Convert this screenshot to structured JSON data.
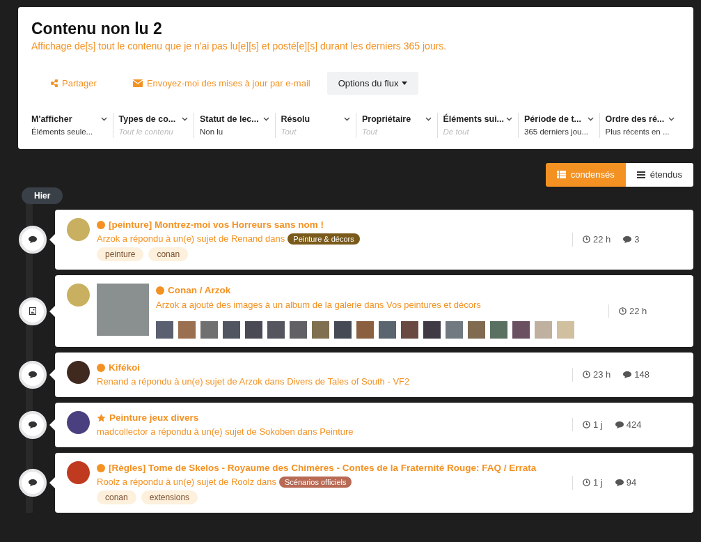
{
  "header": {
    "title": "Contenu non lu 2",
    "subtitle": "Affichage de[s] tout le contenu que je n'ai pas lu[e][s] et posté[e][s] durant les derniers 365 jours."
  },
  "actions": {
    "share": "Partager",
    "email": "Envoyez-moi des mises à jour par e-mail",
    "options": "Options du flux"
  },
  "filters": [
    {
      "label": "M'afficher",
      "value": "Éléments seule...",
      "muted": false
    },
    {
      "label": "Types de co...",
      "value": "Tout le contenu",
      "muted": true
    },
    {
      "label": "Statut de lec...",
      "value": "Non lu",
      "muted": false
    },
    {
      "label": "Résolu",
      "value": "Tout",
      "muted": true
    },
    {
      "label": "Propriétaire",
      "value": "Tout",
      "muted": true
    },
    {
      "label": "Éléments sui...",
      "value": "De tout",
      "muted": true
    },
    {
      "label": "Période de t...",
      "value": "365 derniers jou...",
      "muted": false
    },
    {
      "label": "Ordre des ré...",
      "value": "Plus récents en ...",
      "muted": false
    }
  ],
  "view_toggle": [
    {
      "label": "condensés",
      "selected": true
    },
    {
      "label": "étendus",
      "selected": false
    }
  ],
  "day_label": "Hier",
  "items": [
    {
      "kind": "comment",
      "color": "#c8b060",
      "unread": true,
      "starred": false,
      "title": "[peinture] Montrez-moi vos Horreurs sans nom !",
      "summary": "Arzok a répondu à un(e) sujet de Renand dans",
      "category": {
        "label": "Peinture & décors",
        "color": "#7a5a1a"
      },
      "tags": [
        "peinture",
        "conan"
      ],
      "time": "22 h",
      "replies": "3"
    },
    {
      "kind": "image",
      "color": "#c8b060",
      "unread": true,
      "starred": false,
      "title": "Conan / Arzok",
      "summary": "Arzok a ajouté des images à un album de la galerie dans Vos peintures et décors",
      "thumbnails": [
        {
          "color": "#5a6070"
        },
        {
          "color": "#9a7050"
        },
        {
          "color": "#707070"
        },
        {
          "color": "#505560"
        },
        {
          "color": "#4a4a55"
        },
        {
          "color": "#555560"
        },
        {
          "color": "#606065"
        },
        {
          "color": "#807050"
        },
        {
          "color": "#454a55"
        },
        {
          "color": "#8a6040"
        },
        {
          "color": "#5a6570"
        },
        {
          "color": "#6a4a40"
        },
        {
          "color": "#403a45"
        },
        {
          "color": "#707a80"
        },
        {
          "color": "#806a50"
        },
        {
          "color": "#5a7060"
        },
        {
          "color": "#6a5060"
        },
        {
          "color": "#c0b0a0"
        },
        {
          "color": "#d0c0a0"
        }
      ],
      "time": "22 h"
    },
    {
      "kind": "comment",
      "color": "#402a20",
      "unread": true,
      "starred": false,
      "title": "Kifékoi",
      "summary": "Renand a répondu à un(e) sujet de Arzok dans Divers de Tales of South - VF2",
      "time": "23 h",
      "replies": "148"
    },
    {
      "kind": "comment",
      "color": "#4a4080",
      "unread": false,
      "starred": true,
      "title": "Peinture jeux divers",
      "summary": "madcollector a répondu à un(e) sujet de Sokoben dans Peinture",
      "time": "1 j",
      "replies": "424"
    },
    {
      "kind": "comment",
      "color": "#c03a20",
      "unread": true,
      "starred": false,
      "title": "[Règles] Tome de Skelos - Royaume des Chimères - Contes de la Fraternité Rouge: FAQ / Errata",
      "summary": "Roolz a répondu à un(e) sujet de Roolz dans",
      "category": {
        "label": "Scénarios officiels",
        "color": "#b86a55"
      },
      "tags": [
        "conan",
        "extensions"
      ],
      "time": "1 j",
      "replies": "94"
    }
  ]
}
